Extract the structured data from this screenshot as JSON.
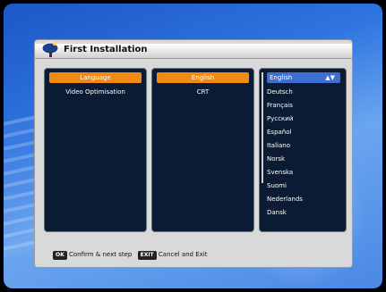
{
  "dialog": {
    "title": "First Installation"
  },
  "menu": {
    "items": [
      "Language",
      "Video Optimisation"
    ],
    "selected_index": 0
  },
  "values": {
    "items": [
      "English",
      "CRT"
    ],
    "selected_index": 0
  },
  "languages": {
    "items": [
      "English",
      "Deutsch",
      "Français",
      "Русский",
      "Español",
      "Italiano",
      "Norsk",
      "Svenska",
      "Suomi",
      "Nederlands",
      "Dansk"
    ],
    "selected_index": 0
  },
  "footer": {
    "ok_key": "OK",
    "ok_text": "Confirm & next step",
    "exit_key": "EXIT",
    "exit_text": "Cancel and Exit"
  },
  "colors": {
    "selected": "#f08a13",
    "language_selected": "#3d6fd3",
    "panel": "#0b1b33"
  }
}
